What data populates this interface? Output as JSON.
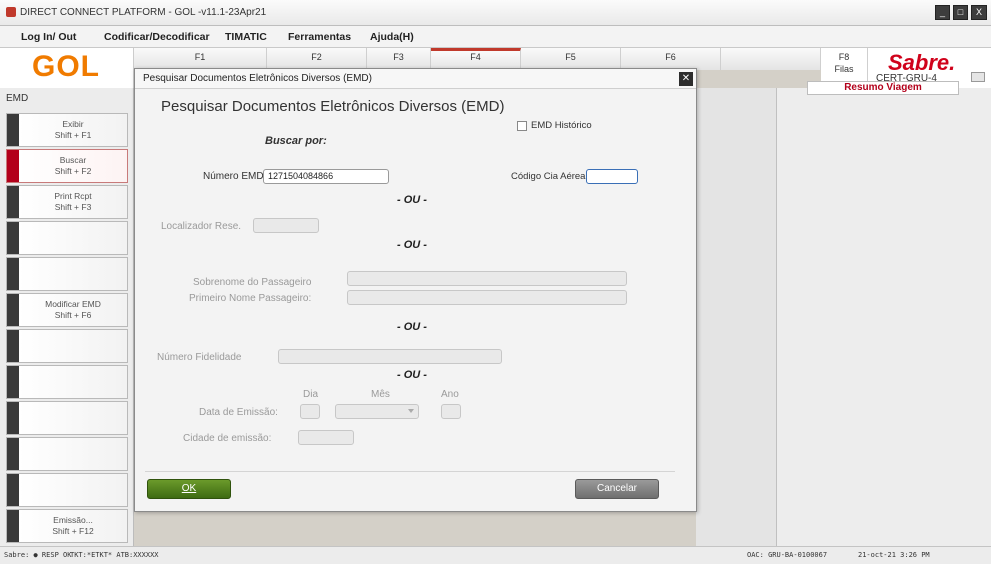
{
  "window": {
    "title": "DIRECT CONNECT PLATFORM - GOL -v11.1-23Apr21",
    "controls": [
      "_",
      "□",
      "X"
    ]
  },
  "menu": [
    "Log In/ Out",
    "Codificar/Decodificar",
    "TIMATIC",
    "Ferramentas",
    "Ajuda(H)"
  ],
  "brand": {
    "logo": "GOL",
    "partner_logo": "Sabre.",
    "env": "CERT-GRU-4",
    "logo_color": "#f07b00",
    "partner_color": "#d0021b"
  },
  "fkeys": [
    {
      "label": "F1",
      "sub": ""
    },
    {
      "label": "F2",
      "sub": ""
    },
    {
      "label": "F3",
      "sub": ""
    },
    {
      "label": "F4",
      "sub": ""
    },
    {
      "label": "F5",
      "sub": ""
    },
    {
      "label": "F6",
      "sub": ""
    },
    {
      "label": "F8",
      "sub": "Filas"
    }
  ],
  "sidebar": {
    "title": "EMD",
    "buttons": [
      {
        "label": "Exibir",
        "shortcut": "Shift + F1"
      },
      {
        "label": "Buscar",
        "shortcut": "Shift + F2"
      },
      {
        "label": "Print Rcpt",
        "shortcut": "Shift + F3"
      },
      {
        "label": "",
        "shortcut": ""
      },
      {
        "label": "",
        "shortcut": ""
      },
      {
        "label": "Modificar EMD",
        "shortcut": "Shift + F6"
      },
      {
        "label": "",
        "shortcut": ""
      },
      {
        "label": "",
        "shortcut": ""
      },
      {
        "label": "",
        "shortcut": ""
      },
      {
        "label": "",
        "shortcut": ""
      },
      {
        "label": "",
        "shortcut": ""
      },
      {
        "label": "Emissão...",
        "shortcut": "Shift + F12"
      }
    ]
  },
  "right_panel": {
    "title": "Resumo Viagem"
  },
  "dialog": {
    "title": "Pesquisar Documentos Eletrônicos Diversos (EMD)",
    "close": "✕",
    "heading": "Pesquisar Documentos Eletrônicos Diversos (EMD)",
    "search_by": "Buscar por:",
    "historico_label": "EMD Histórico",
    "numero_emd_label": "Número EMD:",
    "numero_emd_value": "1271504084866",
    "codigo_cia_label": "Código Cia Aérea",
    "codigo_cia_value": "",
    "ou": "- OU -",
    "localizador_label": "Localizador Rese.",
    "sobrenome_label": "Sobrenome do Passageiro",
    "primeiro_nome_label": "Primeiro Nome Passageiro:",
    "fidelidade_label": "Número Fidelidade",
    "dia_label": "Dia",
    "mes_label": "Mês",
    "ano_label": "Ano",
    "data_emissao_label": "Data de Emissão:",
    "cidade_emissao_label": "Cidade de emissão:",
    "ok_label": "OK",
    "cancel_label": "Cancelar"
  },
  "status": {
    "left": "Sabre: ● RESP OK",
    "tkt": "TKT:*ETKT* ATB:XXXXXX",
    "oac": "OAC: GRU-BA-0100067",
    "datetime": "21-oct-21 3:26 PM"
  }
}
